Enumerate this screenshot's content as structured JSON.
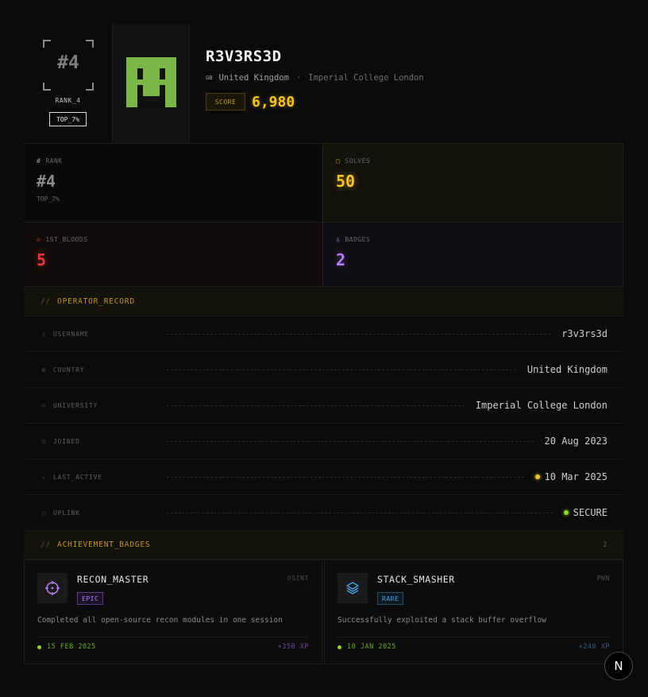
{
  "header": {
    "rank_big": "#4",
    "rank_small": "RANK_4",
    "top_badge": "TOP_7%",
    "username": "R3V3RS3D",
    "flag_code": "GB",
    "country": "United Kingdom",
    "separator": "·",
    "university": "Imperial College London",
    "score_label": "SCORE",
    "score_value": "6,980",
    "avatar_color": "#7ab648"
  },
  "stats": {
    "rank": {
      "label": "RANK",
      "icon": "hash-icon",
      "value": "#4",
      "sub": "TOP_7%",
      "color": "#8a8a8a"
    },
    "solves": {
      "label": "SOLVES",
      "icon": "chip-icon",
      "value": "50",
      "color": "#f5c22a"
    },
    "first_bloods": {
      "label": "1ST_BLOODS",
      "icon": "target-icon",
      "value": "5",
      "color": "#e8363a"
    },
    "badges": {
      "label": "BADGES",
      "icon": "medal-icon",
      "value": "2",
      "color": "#b67cf0"
    }
  },
  "operator_record": {
    "slashes": "//",
    "title": "OPERATOR_RECORD",
    "rows": [
      {
        "icon": "user-icon",
        "label": "USERNAME",
        "value": "r3v3rs3d"
      },
      {
        "icon": "globe-icon",
        "label": "COUNTRY",
        "value": "United Kingdom"
      },
      {
        "icon": "graduation-cap-icon",
        "label": "UNIVERSITY",
        "value": "Imperial College London"
      },
      {
        "icon": "clock-icon",
        "label": "JOINED",
        "value": "20 Aug 2023"
      },
      {
        "icon": "activity-icon",
        "label": "LAST_ACTIVE",
        "value": "10 Mar 2025",
        "dot_color": "#f5c22a"
      },
      {
        "icon": "uplink-icon",
        "label": "UPLINK",
        "value": "SECURE",
        "dot_color": "#8fd62c"
      }
    ]
  },
  "achievements": {
    "slashes": "//",
    "title": "ACHIEVEMENT_BADGES",
    "count": "2",
    "items": [
      {
        "name": "RECON_MASTER",
        "tag": "EPIC",
        "category": "OSINT",
        "icon": "crosshair-icon",
        "description": "Completed all open-source recon modules in one session",
        "date": "15 FEB 2025",
        "xp": "+350 XP",
        "accent": "#b67cf0"
      },
      {
        "name": "STACK_SMASHER",
        "tag": "RARE",
        "category": "PWN",
        "icon": "layers-icon",
        "description": "Successfully exploited a stack buffer overflow",
        "date": "10 JAN 2025",
        "xp": "+240 XP",
        "accent": "#4aa3e0"
      }
    ]
  },
  "floating_button": {
    "label": "N"
  }
}
